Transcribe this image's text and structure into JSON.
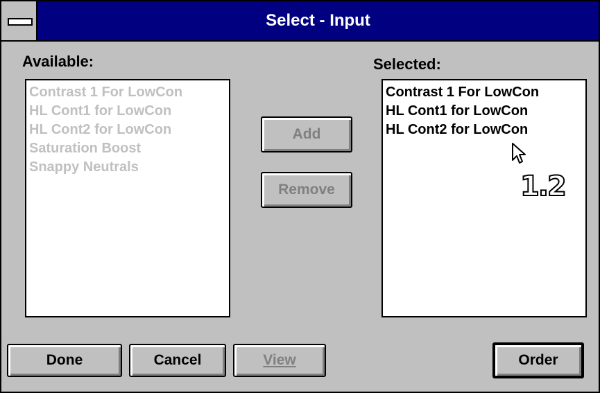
{
  "window": {
    "title": "Select - Input"
  },
  "available": {
    "label": "Available:",
    "items": [
      "Contrast 1 For LowCon",
      "HL Cont1 for LowCon",
      "HL Cont2 for LowCon",
      "Saturation Boost",
      "Snappy Neutrals"
    ],
    "state": "disabled"
  },
  "selected": {
    "label": "Selected:",
    "items": [
      "Contrast 1 For LowCon",
      "HL Cont1 for LowCon",
      "HL Cont2 for LowCon"
    ]
  },
  "buttons": {
    "add": "Add",
    "remove": "Remove",
    "done": "Done",
    "cancel": "Cancel",
    "view": "View",
    "order": "Order"
  },
  "overlay": {
    "version_label": "1.2"
  },
  "colors": {
    "titlebar": "#000080",
    "face": "#c0c0c0",
    "disabled_text": "#c0c0c0"
  }
}
